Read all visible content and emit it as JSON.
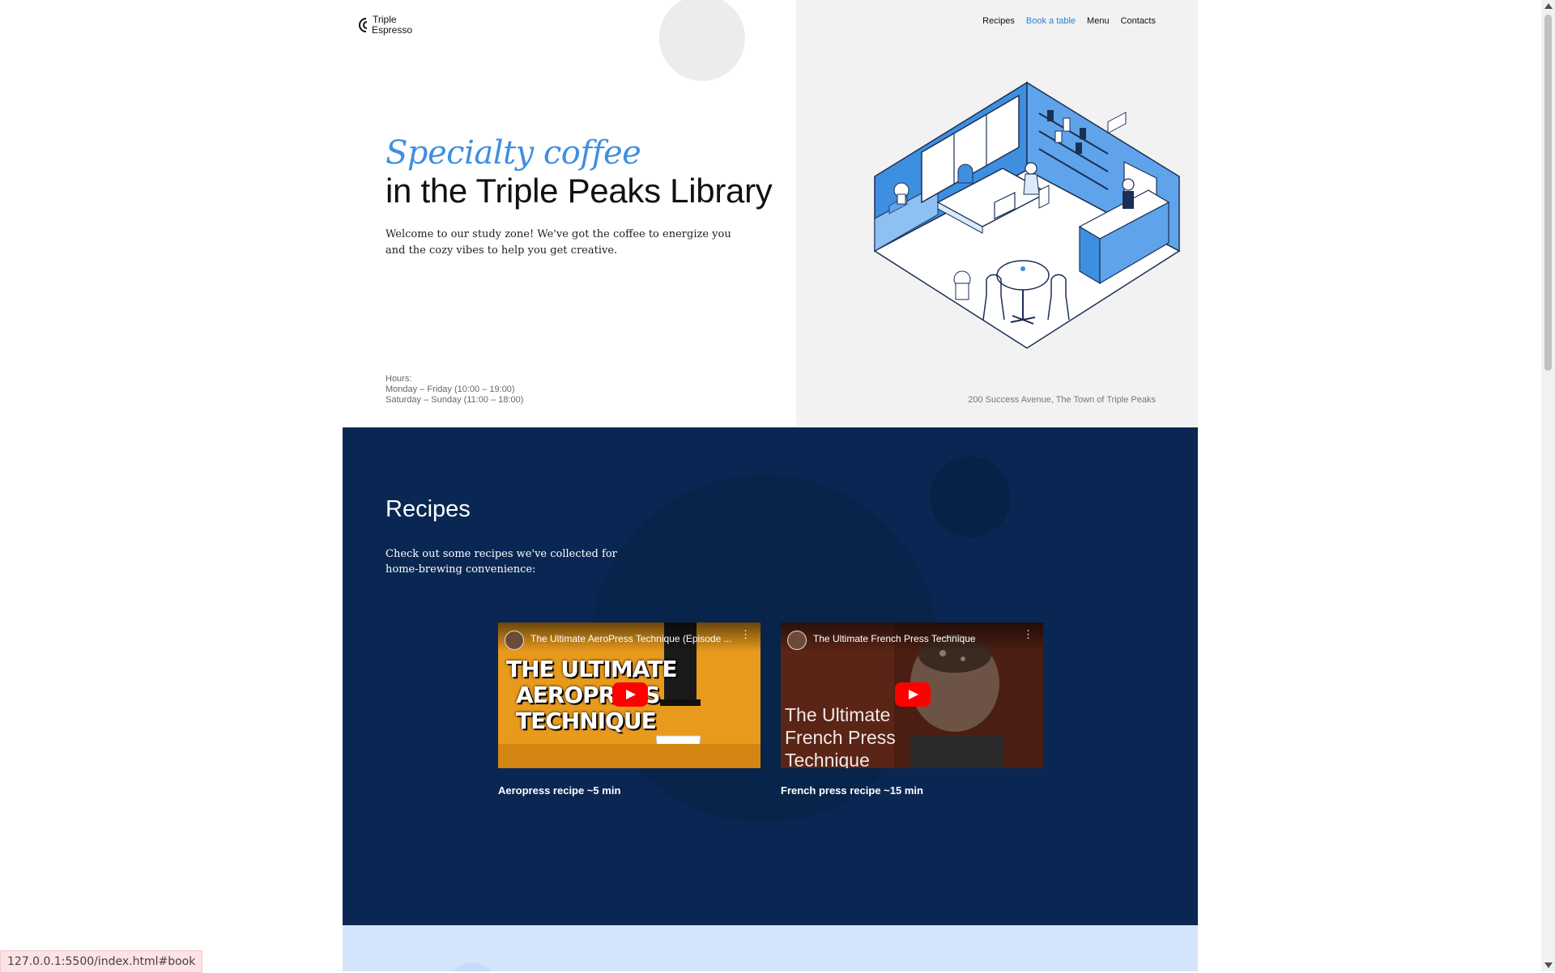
{
  "brand": {
    "name_line1": "Triple",
    "name_line2": "Espresso"
  },
  "nav": {
    "items": [
      {
        "label": "Recipes",
        "active": false
      },
      {
        "label": "Book a table",
        "active": true
      },
      {
        "label": "Menu",
        "active": false
      },
      {
        "label": "Contacts",
        "active": false
      }
    ]
  },
  "hero": {
    "title_italic": "Specialty coffee",
    "title_main": "in the Triple Peaks Library",
    "description": "Welcome to our study zone! We've got the coffee to energize you and the cozy vibes to help you get creative.",
    "hours_label": "Hours:",
    "hours_weekdays": "Monday – Friday (10:00 – 19:00)",
    "hours_weekend": "Saturday – Sunday (11:00 – 18:00)",
    "address": "200 Success Avenue, The Town of Triple Peaks"
  },
  "recipes": {
    "title": "Recipes",
    "subtitle": "Check out some recipes we've collected for home-brewing convenience:",
    "videos": [
      {
        "title": "The Ultimate AeroPress Technique (Episode ...",
        "thumb_text": [
          "THE ULTIMATE",
          "AEROPRESS",
          "TECHNIQUE"
        ],
        "caption": "Aeropress recipe ~5 min"
      },
      {
        "title": "The Ultimate French Press Technique",
        "thumb_text": [
          "The Ultimate",
          "French Press",
          "Technique"
        ],
        "caption": "French press recipe ~15 min"
      }
    ]
  },
  "status_bar": {
    "url": "127.0.0.1:5500/index.html#book"
  },
  "colors": {
    "accent": "#2f80d8",
    "recipes_bg": "#0a2753",
    "hero_bg": "#f4f4f4",
    "next_bg": "#d4e5fb"
  }
}
